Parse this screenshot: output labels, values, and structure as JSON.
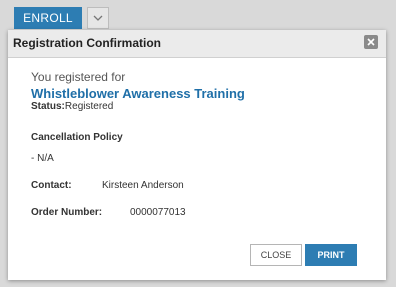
{
  "toolbar": {
    "enroll_label": "ENROLL",
    "dropdown_icon": "chevron-down-icon"
  },
  "modal": {
    "title": "Registration Confirmation",
    "close_icon": "close-icon",
    "registered_for_text": "You registered for",
    "course_title": "Whistleblower Awareness Training",
    "status_label": "Status:",
    "status_value": "Registered",
    "cancellation_policy_title": "Cancellation Policy",
    "cancellation_policy_value": "- N/A",
    "contact_label": "Contact:",
    "contact_value": "Kirsteen Anderson",
    "order_number_label": "Order Number:",
    "order_number_value": "0000077013",
    "close_button_label": "CLOSE",
    "print_button_label": "PRINT"
  },
  "colors": {
    "accent": "#2d7db3",
    "course_title": "#1f6fa8",
    "backdrop": "#d9d9d9",
    "header_bg": "#ebebeb"
  }
}
